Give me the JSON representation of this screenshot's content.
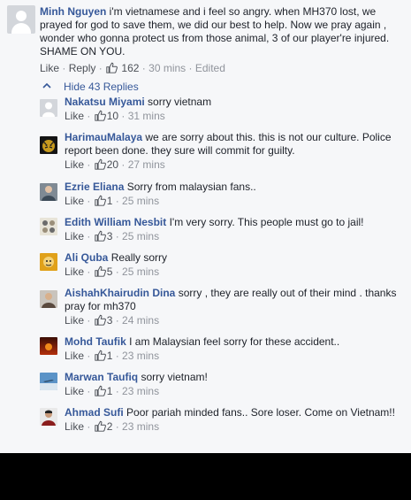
{
  "top_comment": {
    "author": "Minh Nguyen",
    "text": "i'm vietnamese and i feel so angry. when MH370 lost, we prayed for god to save them, we did our best to help. Now we pray again , wonder who gonna protect us from those animal, 3 of our player're injured. SHAME ON YOU.",
    "like_label": "Like",
    "reply_label": "Reply",
    "like_count": "162",
    "time": "30 mins",
    "edited": "Edited"
  },
  "toggle": {
    "label": "Hide 43 Replies"
  },
  "replies": [
    {
      "author": "Nakatsu Miyami",
      "text": "sorry vietnam",
      "like_label": "Like",
      "like_count": "10",
      "time": "31 mins",
      "avatar": "default-avatar"
    },
    {
      "author": "HarimauMalaya",
      "text": "we are sorry about this. this is not our culture. Police report been done. they sure will commit for guilty.",
      "like_label": "Like",
      "like_count": "20",
      "time": "27 mins",
      "avatar": "tiger-avatar"
    },
    {
      "author": "Ezrie Eliana",
      "text": "Sorry from malaysian fans..",
      "like_label": "Like",
      "like_count": "1",
      "time": "25 mins",
      "avatar": "person-avatar"
    },
    {
      "author": "Edith William Nesbit",
      "text": "I'm very sorry. This people must go to jail!",
      "like_label": "Like",
      "like_count": "3",
      "time": "25 mins",
      "avatar": "pattern-avatar"
    },
    {
      "author": "Ali Quba",
      "text": "Really sorry",
      "like_label": "Like",
      "like_count": "5",
      "time": "25 mins",
      "avatar": "cartoon-avatar"
    },
    {
      "author": "AishahKhairudin Dina",
      "text": "sorry , they are really out of their mind . thanks pray for mh370",
      "like_label": "Like",
      "like_count": "3",
      "time": "24 mins",
      "avatar": "person-avatar"
    },
    {
      "author": "Mohd Taufik",
      "text": "I am Malaysian feel sorry for these accident..",
      "like_label": "Like",
      "like_count": "1",
      "time": "23 mins",
      "avatar": "sunset-avatar"
    },
    {
      "author": "Marwan Taufiq",
      "text": "sorry vietnam!",
      "like_label": "Like",
      "like_count": "1",
      "time": "23 mins",
      "avatar": "sky-avatar"
    },
    {
      "author": "Ahmad Sufi",
      "text": "Poor pariah minded fans.. Sore loser. Come on Vietnam!!",
      "like_label": "Like",
      "like_count": "2",
      "time": "23 mins",
      "avatar": "portrait-avatar"
    }
  ]
}
